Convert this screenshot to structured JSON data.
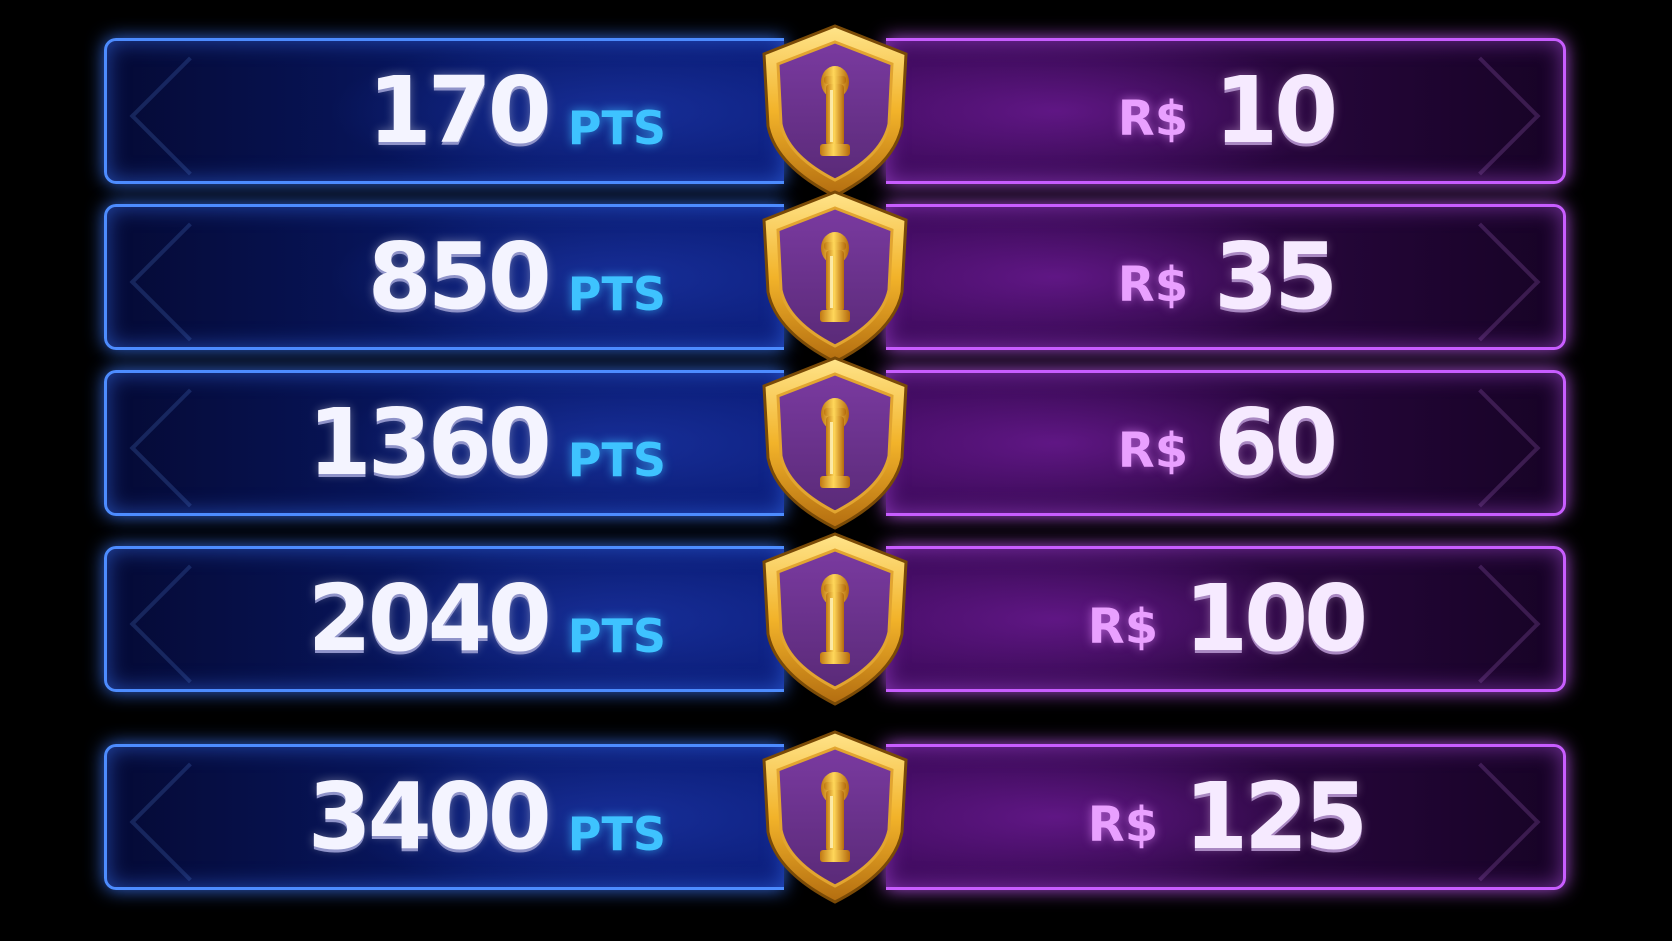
{
  "colors": {
    "left_border": "#4d8cff",
    "right_border": "#c85dff",
    "pts_unit": "#3ec3ff",
    "brl_unit": "#e9a0ff",
    "shield_gold": "#f2b32a",
    "shield_inner": "#5a2a78"
  },
  "rows": [
    {
      "points": "170",
      "points_unit": "PTS",
      "currency": "R$",
      "price": "10",
      "icon": "shield-pillar-icon"
    },
    {
      "points": "850",
      "points_unit": "PTS",
      "currency": "R$",
      "price": "35",
      "icon": "shield-pillar-icon"
    },
    {
      "points": "1360",
      "points_unit": "PTS",
      "currency": "R$",
      "price": "60",
      "icon": "shield-pillar-icon"
    },
    {
      "points": "2040",
      "points_unit": "PTS",
      "currency": "R$",
      "price": "100",
      "icon": "shield-pillar-icon"
    },
    {
      "points": "3400",
      "points_unit": "PTS",
      "currency": "R$",
      "price": "125",
      "icon": "shield-pillar-icon"
    }
  ]
}
